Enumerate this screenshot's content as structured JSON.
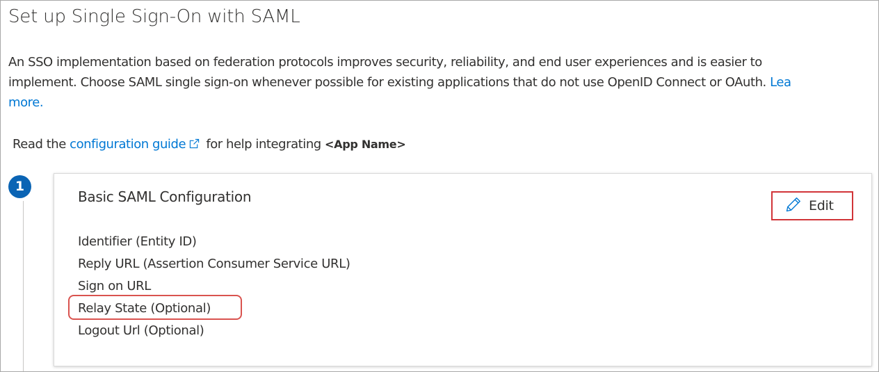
{
  "page": {
    "title": "Set up Single Sign-On with SAML"
  },
  "intro": {
    "line1": "An SSO implementation based on federation protocols improves security, reliability, and end user experiences and is easier to",
    "line2_text": "implement. Choose SAML single sign-on whenever possible for existing applications that do not use OpenID Connect or OAuth.",
    "line2_link": "Lea",
    "line3_link": "more."
  },
  "guide": {
    "prefix": "Read the",
    "link": "configuration guide",
    "middle": "for help integrating",
    "app_name": "<App Name>",
    "icon": "external-link-icon"
  },
  "step": {
    "number": "1"
  },
  "card": {
    "title": "Basic SAML Configuration",
    "edit_label": "Edit",
    "edit_icon": "pencil-icon",
    "fields": [
      "Identifier (Entity ID)",
      "Reply URL (Assertion Consumer Service URL)",
      "Sign on URL",
      "Relay State (Optional)",
      "Logout Url (Optional)"
    ]
  },
  "colors": {
    "accent": "#0078d4",
    "badge": "#0a64b4",
    "highlight": "#d13438"
  }
}
